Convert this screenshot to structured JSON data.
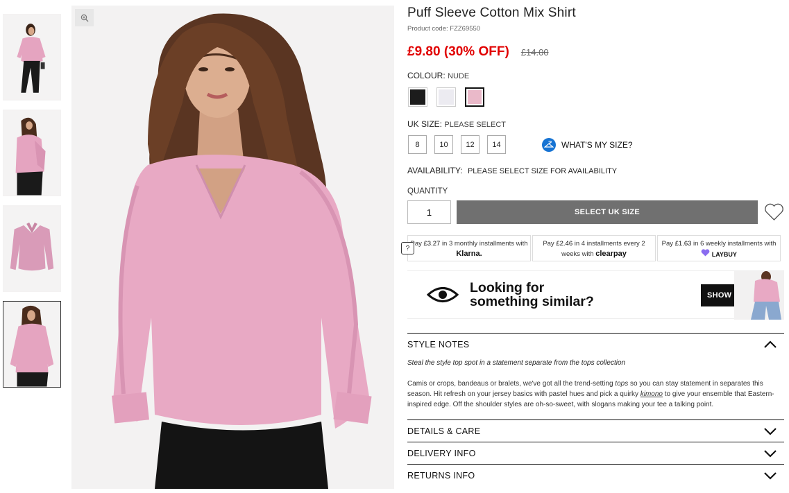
{
  "product": {
    "title": "Puff Sleeve Cotton Mix Shirt",
    "code_label": "Product code:",
    "code": "FZZ69550",
    "price_now": "£9.80 (30% OFF)",
    "price_was": "£14.00"
  },
  "colour": {
    "label": "COLOUR:",
    "selected": "NUDE",
    "swatches": [
      {
        "name": "black",
        "color": "#1c1c1c"
      },
      {
        "name": "white",
        "color": "#ecebf1"
      },
      {
        "name": "nude",
        "color": "#eab9c9"
      }
    ]
  },
  "size": {
    "label": "UK SIZE:",
    "prompt": "PLEASE SELECT",
    "options": [
      "8",
      "10",
      "12",
      "14"
    ],
    "whats_my_size": "WHAT'S MY SIZE?"
  },
  "availability": {
    "label": "AVAILABILITY:",
    "value": "PLEASE SELECT SIZE FOR AVAILABILITY"
  },
  "quantity": {
    "label": "QUANTITY",
    "value": "1"
  },
  "cta": {
    "select_size": "SELECT UK SIZE"
  },
  "help_badge": "?",
  "installments": [
    {
      "pre": "Pay",
      "amount": "£3.27",
      "mid": "in 3 monthly installments with",
      "brand": "Klarna."
    },
    {
      "pre": "Pay",
      "amount": "£2.46",
      "mid": "in 4 installments every 2 weeks with",
      "brand": "clearpay"
    },
    {
      "pre": "Pay",
      "amount": "£1.63",
      "mid": "in 6 weekly installments with",
      "brand": "LAYBUY"
    }
  ],
  "similar": {
    "line1": "Looking for",
    "line2": "something similar?",
    "button": "SHOW SIMILAR"
  },
  "style_notes": {
    "title": "STYLE NOTES",
    "tagline": "Steal the style top spot in a statement separate from the tops collection",
    "p1": "Camis or crops, bandeaus or bralets, we've got all the trend-setting",
    "p1_link": "tops",
    "p2": "so you can stay statement in separates this season. Hit refresh on your jersey basics with pastel hues and pick a quirky",
    "p2_link": "kimono",
    "p3": "to give your ensemble that Eastern-inspired edge. Off the shoulder styles are oh-so-sweet, with slogans making your tee a talking point."
  },
  "sections": [
    {
      "title": "DETAILS & CARE"
    },
    {
      "title": "DELIVERY INFO"
    },
    {
      "title": "RETURNS INFO"
    }
  ],
  "colors": {
    "sale_red": "#e10000",
    "cta_grey": "#707070",
    "shirt_pink": "#e8a9c4",
    "info_blue": "#1673d3"
  }
}
